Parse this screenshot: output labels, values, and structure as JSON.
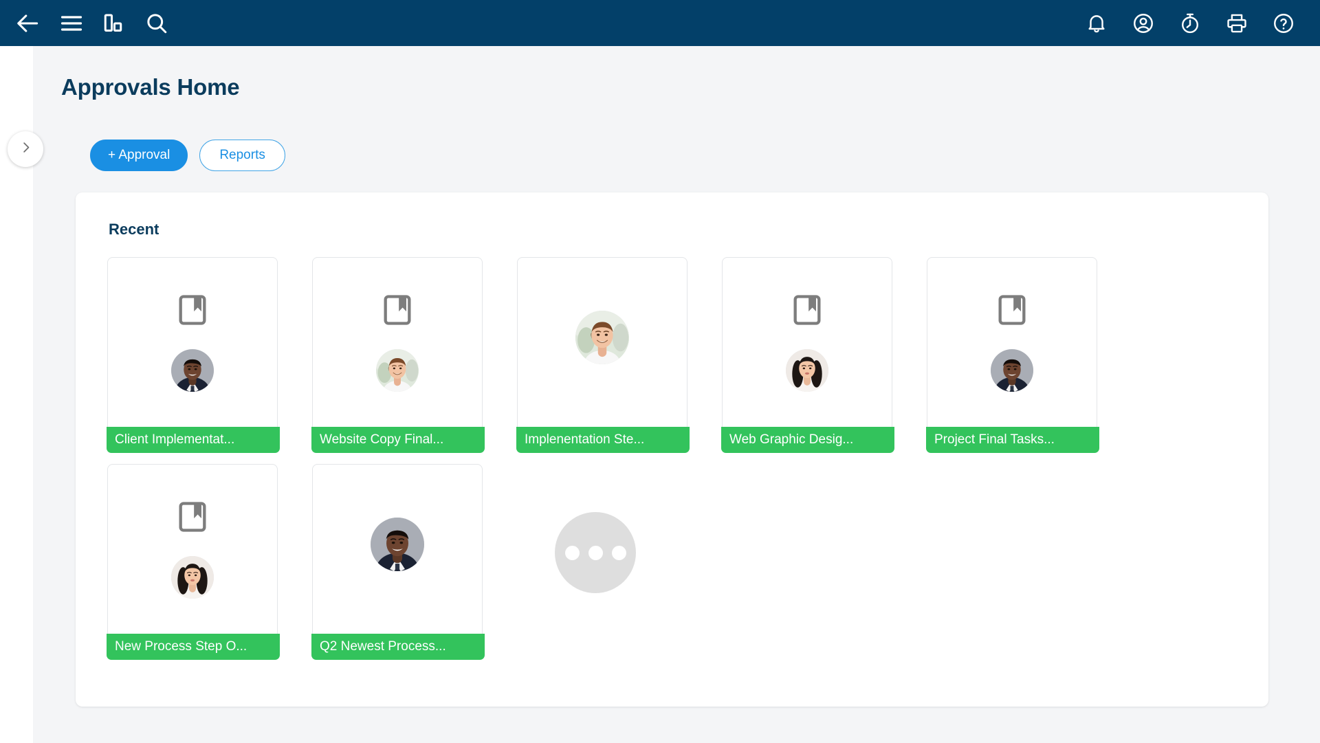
{
  "topbar": {
    "left_icons": [
      {
        "name": "back-arrow-icon",
        "label": "Back"
      },
      {
        "name": "hamburger-menu-icon",
        "label": "Menu"
      },
      {
        "name": "chart-icon",
        "label": "Charts"
      },
      {
        "name": "search-icon",
        "label": "Search"
      }
    ],
    "right_icons": [
      {
        "name": "notification-bell-icon",
        "label": "Notifications"
      },
      {
        "name": "user-account-icon",
        "label": "Account"
      },
      {
        "name": "timer-icon",
        "label": "Timer"
      },
      {
        "name": "printer-icon",
        "label": "Print"
      },
      {
        "name": "help-icon",
        "label": "Help"
      }
    ],
    "background_color": "#034069"
  },
  "sidebar_toggle": {
    "icon": "chevron-right-icon",
    "label": "Expand sidebar"
  },
  "header": {
    "title": "Approvals Home"
  },
  "actions": {
    "primary_label": "+ Approval",
    "secondary_label": "Reports",
    "primary_color": "#1a8fe3",
    "secondary_color": "#1a8fe3"
  },
  "panel": {
    "title": "Recent",
    "status_color": "#33c35c",
    "cards": [
      {
        "label": "Client Implementat...",
        "icon": "bookmark-icon",
        "avatar": "man-dark-suit",
        "has_icon": true
      },
      {
        "label": "Website Copy Final...",
        "icon": "bookmark-icon",
        "avatar": "man-brown-hair",
        "has_icon": true
      },
      {
        "label": "Implenentation Ste...",
        "icon": "",
        "avatar": "man-brown-hair",
        "has_icon": false
      },
      {
        "label": "Web Graphic Desig...",
        "icon": "bookmark-icon",
        "avatar": "woman-dark-hair",
        "has_icon": true
      },
      {
        "label": "Project Final Tasks...",
        "icon": "bookmark-icon",
        "avatar": "man-dark-suit",
        "has_icon": true
      },
      {
        "label": "New Process Step O...",
        "icon": "bookmark-icon",
        "avatar": "woman-dark-hair",
        "has_icon": true
      },
      {
        "label": "Q2 Newest Process...",
        "icon": "",
        "avatar": "man-dark-suit",
        "has_icon": false
      }
    ],
    "more_button": {
      "name": "more-options-button",
      "label": "More"
    }
  }
}
